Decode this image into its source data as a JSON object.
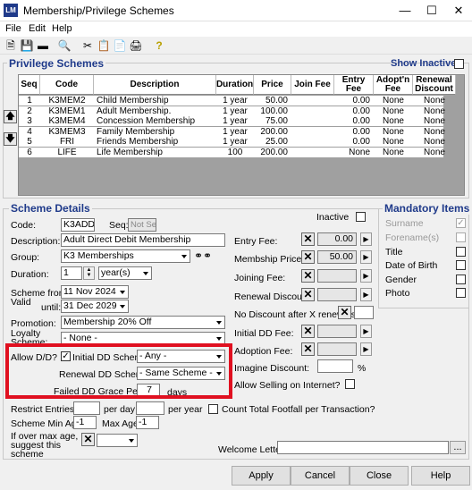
{
  "window": {
    "title": "Membership/Privilege Schemes",
    "app_icon": "LM"
  },
  "menu": [
    "File",
    "Edit",
    "Help"
  ],
  "privilege": {
    "title": "Privilege Schemes",
    "show_inactive": "Show Inactive",
    "columns": [
      "Seq",
      "Code",
      "Description",
      "Duration",
      "Price",
      "Join Fee",
      "Entry Fee",
      "Adopt'n Fee",
      "Renewal Discount"
    ],
    "rows": [
      [
        "1",
        "K3MEM2",
        "Child Membership",
        "1 year",
        "50.00",
        "0.00",
        "None",
        "None"
      ],
      [
        "2",
        "K3MEM1",
        "Adult Membership.",
        "1 year",
        "100.00",
        "0.00",
        "None",
        "None"
      ],
      [
        "3",
        "K3MEM4",
        "Concession Membership",
        "1 year",
        "75.00",
        "0.00",
        "None",
        "None"
      ],
      [
        "4",
        "K3MEM3",
        "Family Membership",
        "1 year",
        "200.00",
        "0.00",
        "None",
        "None"
      ],
      [
        "5",
        "FRI",
        "Friends Membership",
        "1 year",
        "25.00",
        "0.00",
        "None",
        "None"
      ],
      [
        "6",
        "LIFE",
        "Life Membership",
        "100",
        "200.00",
        "None",
        "None",
        "None"
      ]
    ]
  },
  "details": {
    "title": "Scheme Details",
    "inactive": "Inactive",
    "code_label": "Code:",
    "code": "K3ADDD",
    "seq_label": "Seq:",
    "seq_ph": "Not Set",
    "desc_label": "Description:",
    "desc": "Adult Direct Debit Membership",
    "group_label": "Group:",
    "group": "K3 Memberships",
    "duration_label": "Duration:",
    "duration": "1",
    "duration_unit": "year(s)",
    "from_label": "Scheme from:",
    "from": "11 Nov 2024",
    "valid_label": "Valid",
    "until_label": "until:",
    "until": "31 Dec 2029",
    "promo_label": "Promotion:",
    "promo": "Membership 20% Off",
    "loyalty_label": "Loyalty Scheme:",
    "loyalty": "- None -",
    "allow_dd": "Allow D/D?",
    "initial_dd": "Initial DD Scheme:",
    "initial_dd_val": "- Any -",
    "renewal_dd": "Renewal DD Scheme:",
    "renewal_dd_val": "- Same Scheme -",
    "grace": "Failed DD Grace Period:",
    "grace_val": "7",
    "days": "days",
    "restrict": "Restrict Entries to:",
    "per_day": "per day",
    "per_year": "per year",
    "footfall": "Count Total Footfall per Transaction?",
    "min_age": "Scheme Min Age",
    "min_age_val": "-1",
    "max_age": "Max Age",
    "max_age_val": "-1",
    "over_age": "If over max age, suggest this scheme",
    "entry_fee": "Entry Fee:",
    "entry_fee_val": "0.00",
    "price": "Membship Price:",
    "price_val": "50.00",
    "joining": "Joining Fee:",
    "renewal_disc": "Renewal Discount:",
    "no_disc": "No Discount after X renewals:",
    "initial_dd_fee": "Initial DD Fee:",
    "adoption": "Adoption Fee:",
    "imagine": "Imagine Discount:",
    "pct": "%",
    "selling": "Allow Selling on Internet?",
    "welcome": "Welcome Letter:",
    "browse": "..."
  },
  "mandatory": {
    "title": "Mandatory Items",
    "items": [
      "Surname",
      "Forename(s)",
      "Title",
      "Date of Birth",
      "Gender",
      "Photo"
    ]
  },
  "buttons": {
    "apply": "Apply",
    "cancel": "Cancel",
    "close": "Close",
    "help": "Help"
  }
}
